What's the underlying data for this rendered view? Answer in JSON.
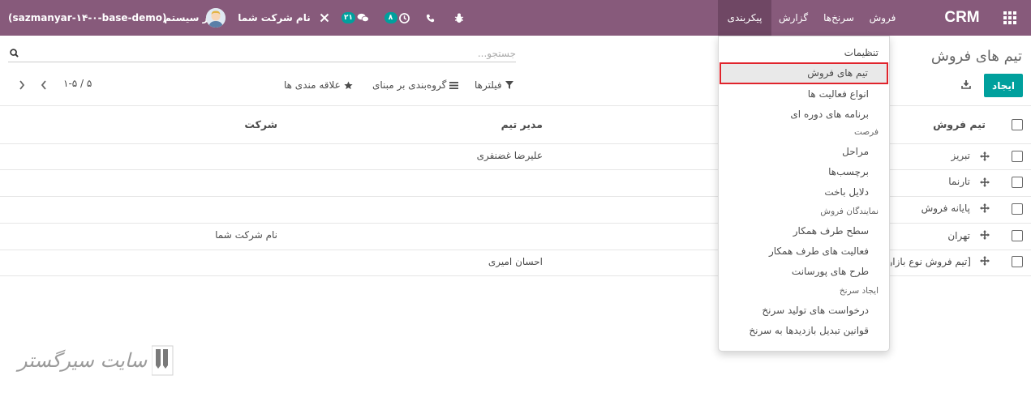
{
  "navbar": {
    "app_name": "CRM",
    "menus": [
      "فروش",
      "سرنخ‌ها",
      "گزارش",
      "پیکربندی"
    ],
    "active_menu": "پیکربندی",
    "activity_count": "۸",
    "message_count": "۲۱",
    "company": "نام شرکت شما",
    "user": "مدیر سیستم",
    "database": "(sazmanyar-۱۴-۰-base-demo)"
  },
  "control_panel": {
    "title": "تیم های فروش",
    "search_placeholder": "جستجو...",
    "create_label": "ایجاد",
    "filters_label": "فیلترها",
    "groupby_label": "گروه‌بندی بر مبنای",
    "favorites_label": "علاقه مندی ها",
    "pager_value": "۱-۵ / ۵"
  },
  "table": {
    "columns": [
      "تیم فروش",
      "مدیر تیم",
      "شرکت"
    ],
    "rows": [
      {
        "team": "تبریز",
        "leader": "علیرضا غضنفری",
        "company": ""
      },
      {
        "team": "تارنما",
        "leader": "",
        "company": ""
      },
      {
        "team": "پایانه فروش",
        "leader": "",
        "company": ""
      },
      {
        "team": "تهران",
        "leader": "",
        "company": "نام شرکت شما"
      },
      {
        "team": "[تیم فروش نوع بازار",
        "leader": "احسان امیری",
        "company": ""
      }
    ]
  },
  "dropdown": {
    "settings_header": "تنظیمات",
    "items_top": [
      "تیم های فروش",
      "انواع فعالیت ها",
      "برنامه های دوره ای"
    ],
    "opportunity_header": "فرصت",
    "opportunity_items": [
      "مراحل",
      "برچسب‌ها",
      "دلایل باخت"
    ],
    "reps_header": "نمایندگان فروش",
    "reps_items": [
      "سطح طرف همکار",
      "فعالیت های طرف همکار",
      "طرح های پورسانت"
    ],
    "leadgen_header": "ایجاد سرنخ",
    "leadgen_items": [
      "درخواست های تولید سرنخ",
      "قوانین تبدیل بازدیدها به سرنخ"
    ],
    "selected_item": "تیم های فروش"
  },
  "colors": {
    "navbar": "#875a7b",
    "primary_button": "#00a09d",
    "highlight_border": "#e0242c"
  },
  "watermark": "سایت سیرگستر"
}
